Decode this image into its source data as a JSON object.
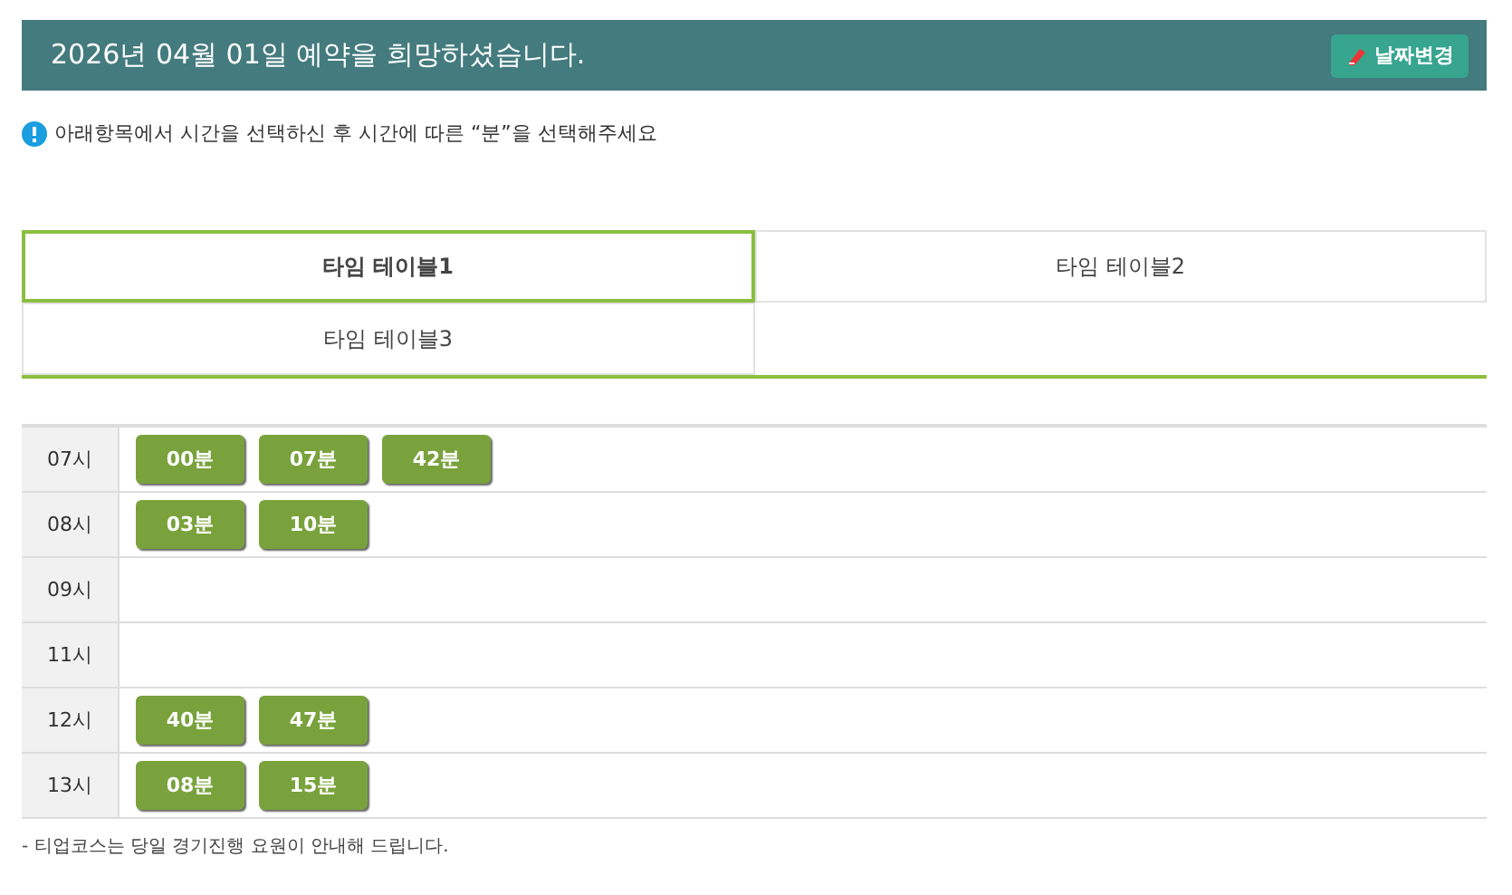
{
  "header": {
    "title": "2026년 04월 01일 예약을 희망하셨습니다.",
    "button": "날짜변경"
  },
  "notice": "아래항목에서 시간을 선택하신 후 시간에 따른 “분”을 선택해주세요",
  "tabs": [
    {
      "label": "타임 테이블1",
      "selected": true
    },
    {
      "label": "타임 테이블2",
      "selected": false
    },
    {
      "label": "타임 테이블3",
      "selected": false
    }
  ],
  "rows": [
    {
      "hour": "07시",
      "minutes": [
        "00분",
        "07분",
        "42분"
      ]
    },
    {
      "hour": "08시",
      "minutes": [
        "03분",
        "10분"
      ]
    },
    {
      "hour": "09시",
      "minutes": []
    },
    {
      "hour": "11시",
      "minutes": []
    },
    {
      "hour": "12시",
      "minutes": [
        "40분",
        "47분"
      ]
    },
    {
      "hour": "13시",
      "minutes": [
        "08분",
        "15분"
      ]
    }
  ],
  "footnote": "- 티업코스는 당일 경기진행 요원이 안내해 드립니다."
}
